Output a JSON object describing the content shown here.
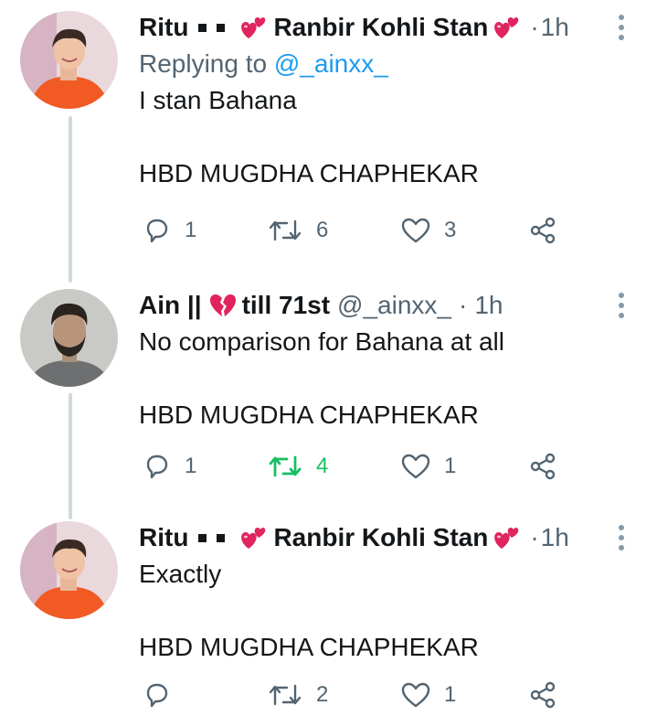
{
  "tweets": [
    {
      "name": "Ritu",
      "name_suffix": "Ranbir Kohli Stan",
      "handle": "",
      "time": "1h",
      "replying_prefix": "Replying to ",
      "replying_to": "@_ainxx_",
      "text": "I stan Bahana\n\nHBD MUGDHA CHAPHEKAR",
      "replies": "1",
      "retweets": "6",
      "likes": "3",
      "retweeted": false,
      "avatar": "young-man-orange-shirt"
    },
    {
      "name": "Ain ||",
      "name_suffix": "till 71st",
      "handle": "@_ainxx_",
      "time": "1h",
      "text": "No comparison for Bahana at all\n\nHBD MUGDHA CHAPHEKAR",
      "replies": "1",
      "retweets": "4",
      "likes": "1",
      "retweeted": true,
      "avatar": "bearded-man-portrait"
    },
    {
      "name": "Ritu",
      "name_suffix": "Ranbir Kohli Stan",
      "handle": "",
      "time": "1h",
      "text": "Exactly\n\nHBD MUGDHA CHAPHEKAR",
      "replies": "",
      "retweets": "2",
      "likes": "1",
      "retweeted": false,
      "avatar": "young-man-orange-shirt"
    }
  ],
  "colors": {
    "text": "#14171a",
    "muted": "#536471",
    "link": "#1d9bf0",
    "retweet_active": "#17bf63",
    "thread_line": "#cfd9de",
    "heart_emoji": "#e0245e"
  },
  "icons": {
    "reply": "reply-icon",
    "retweet": "retweet-icon",
    "like": "like-icon",
    "share": "share-icon",
    "more": "more-options-icon"
  }
}
